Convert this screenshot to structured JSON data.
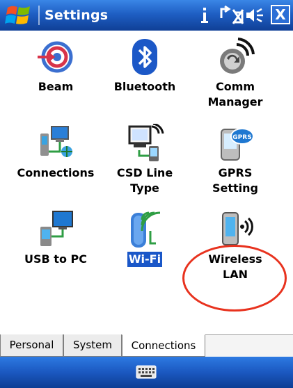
{
  "titlebar": {
    "title": "Settings",
    "start_icon": "windows-flag-icon",
    "status_icons": [
      "connectivity-icon",
      "no-sync-icon",
      "volume-icon"
    ],
    "close_label": "X"
  },
  "items": [
    {
      "label": "Beam",
      "icon": "beam-icon"
    },
    {
      "label": "Bluetooth",
      "icon": "bluetooth-icon"
    },
    {
      "label": "Comm\nManager",
      "icon": "comm-manager-icon"
    },
    {
      "label": "Connections",
      "icon": "connections-icon"
    },
    {
      "label": "CSD Line\nType",
      "icon": "csd-line-type-icon"
    },
    {
      "label": "GPRS\nSetting",
      "icon": "gprs-setting-icon"
    },
    {
      "label": "USB to PC",
      "icon": "usb-to-pc-icon"
    },
    {
      "label": "Wi-Fi",
      "icon": "wifi-icon",
      "selected": true
    },
    {
      "label": "Wireless\nLAN",
      "icon": "wireless-lan-icon"
    }
  ],
  "tabs": [
    {
      "label": "Personal",
      "active": false
    },
    {
      "label": "System",
      "active": false
    },
    {
      "label": "Connections",
      "active": true
    }
  ],
  "softbar": {
    "center_icon": "keyboard-icon"
  },
  "colors": {
    "title_bar": "#1f5fc4",
    "selection": "#1a57c8",
    "annotation": "#e8321e"
  }
}
